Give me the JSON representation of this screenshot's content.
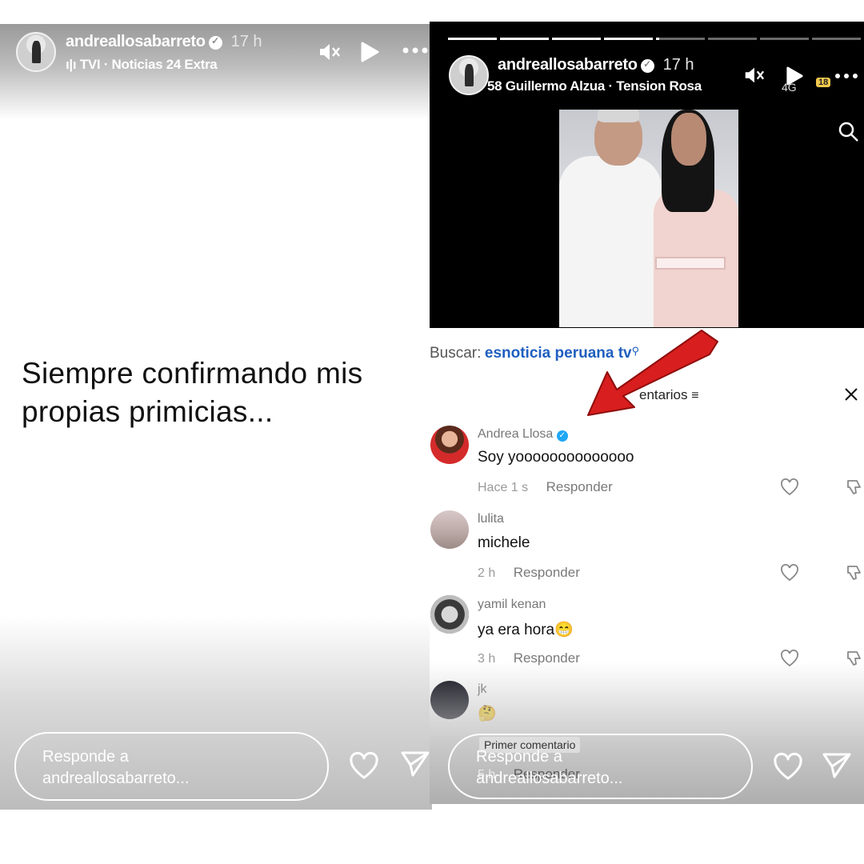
{
  "left_story": {
    "username": "andreallosabarreto",
    "time": "17 h",
    "music": "TVI · Noticias 24 Extra",
    "caption_line1": "Siempre confirmando mis",
    "caption_line2": "propias primicias...",
    "reply_line1": "Responde a",
    "reply_line2": "andreallosabarreto..."
  },
  "right_story": {
    "username": "andreallosabarreto",
    "time": "17 h",
    "music_prefix": "58",
    "music": "Guillermo Alzua · Tension Rosa",
    "status_net": "4G",
    "status_battery": "18",
    "search_label": "Buscar:",
    "search_query": "esnoticia peruana tv",
    "comments_header": "entarios",
    "comments": [
      {
        "name": "Andrea Llosa",
        "verified": true,
        "text": "Soy yoooooooooooooo",
        "time": "Hace 1 s",
        "reply": "Responder"
      },
      {
        "name": "lulita",
        "verified": false,
        "text": "michele",
        "time": "2 h",
        "reply": "Responder"
      },
      {
        "name": "yamil kenan",
        "verified": false,
        "text": "ya era hora",
        "emoji": "😁",
        "time": "3 h",
        "reply": "Responder"
      },
      {
        "name": "jk",
        "verified": false,
        "text": "",
        "emoji": "🤔",
        "time": "5 h",
        "reply": "Responder"
      }
    ],
    "tooltip": "Primer comentario",
    "reply_line1": "Responde a",
    "reply_line2": "andreallosabarreto..."
  },
  "icons": {
    "mute": "mute-icon",
    "play": "play-icon",
    "more": "more-icon",
    "heart": "heart-icon",
    "send": "send-icon",
    "search": "search-icon",
    "close": "close-icon",
    "filter": "filter-icon",
    "dislike": "dislike-icon"
  },
  "colors": {
    "link_blue": "#1f5fbf",
    "arrow_red": "#d81e1e",
    "verified_blue": "#20a7f5"
  }
}
